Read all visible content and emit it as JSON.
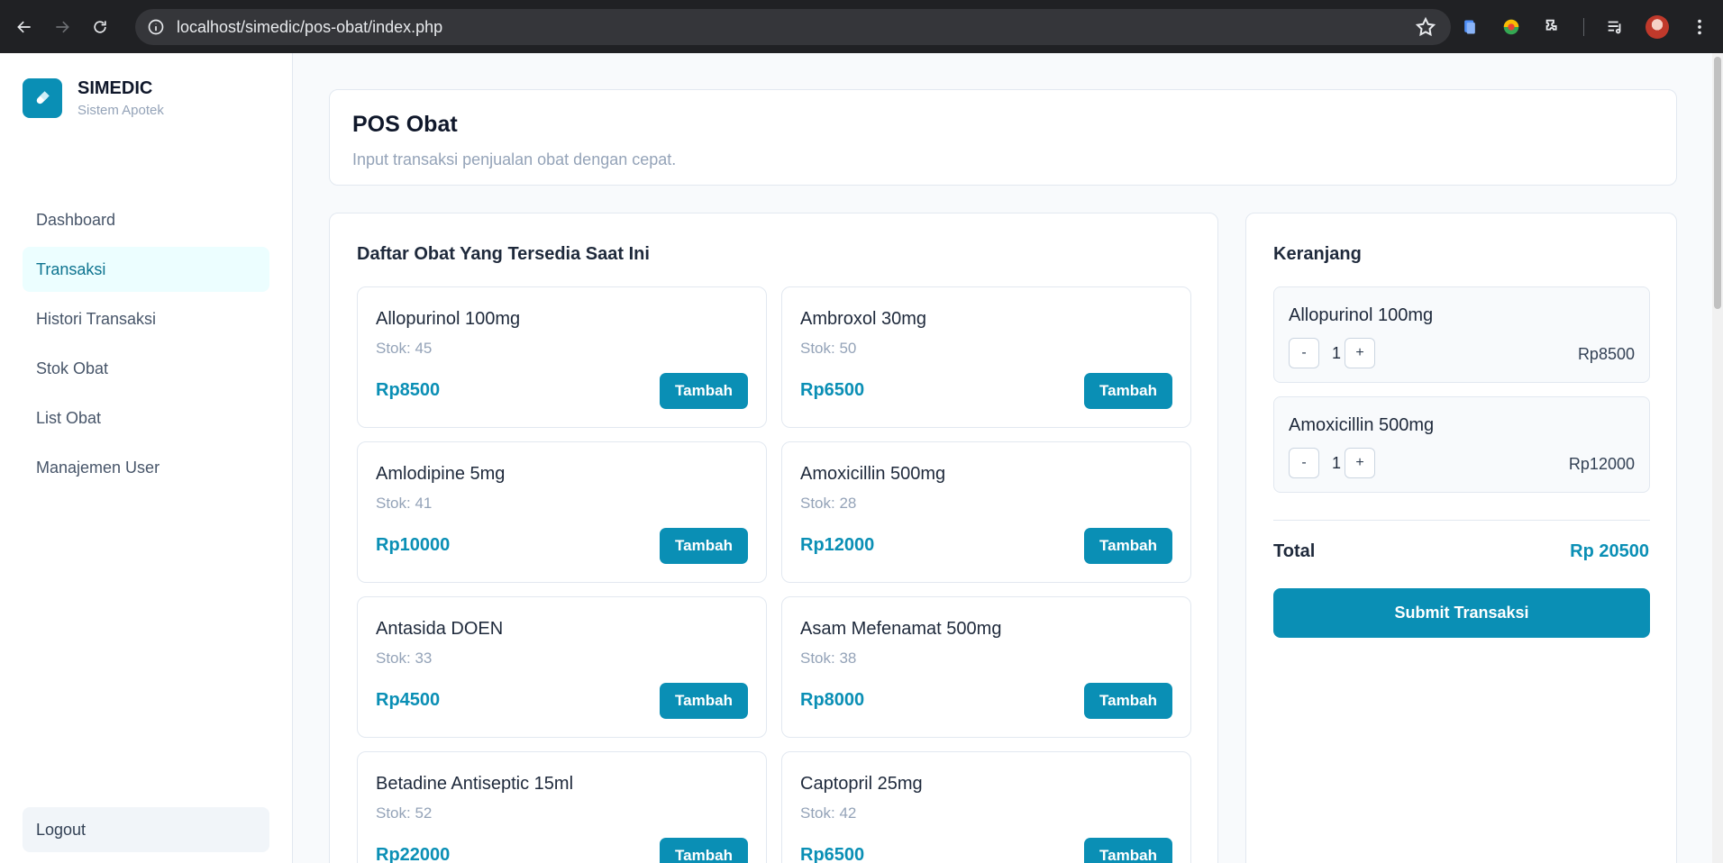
{
  "browser": {
    "url": "localhost/simedic/pos-obat/index.php",
    "icons": [
      "back-icon",
      "forward-icon",
      "reload-icon",
      "info-icon",
      "star-icon",
      "extension-icon",
      "menu-icon"
    ]
  },
  "brand": {
    "name": "SIMEDIC",
    "subtitle": "Sistem Apotek",
    "color": "#0a8fb5"
  },
  "sidebar": {
    "items": [
      {
        "label": "Dashboard"
      },
      {
        "label": "Transaksi",
        "active": true
      },
      {
        "label": "Histori Transaksi"
      },
      {
        "label": "Stok Obat"
      },
      {
        "label": "List Obat"
      },
      {
        "label": "Manajemen User"
      }
    ],
    "logout": "Logout"
  },
  "header": {
    "title": "POS Obat",
    "subtitle": "Input transaksi penjualan obat dengan cepat."
  },
  "products": {
    "title": "Daftar Obat Yang Tersedia Saat Ini",
    "button_label": "Tambah",
    "items": [
      {
        "name": "Allopurinol 100mg",
        "stock": "Stok: 45",
        "price": "Rp8500"
      },
      {
        "name": "Ambroxol 30mg",
        "stock": "Stok: 50",
        "price": "Rp6500"
      },
      {
        "name": "Amlodipine 5mg",
        "stock": "Stok: 41",
        "price": "Rp10000"
      },
      {
        "name": "Amoxicillin 500mg",
        "stock": "Stok: 28",
        "price": "Rp12000"
      },
      {
        "name": "Antasida DOEN",
        "stock": "Stok: 33",
        "price": "Rp4500"
      },
      {
        "name": "Asam Mefenamat 500mg",
        "stock": "Stok: 38",
        "price": "Rp8000"
      },
      {
        "name": "Betadine Antiseptic 15ml",
        "stock": "Stok: 52",
        "price": "Rp22000"
      },
      {
        "name": "Captopril 25mg",
        "stock": "Stok: 42",
        "price": "Rp6500"
      }
    ]
  },
  "cart": {
    "title": "Keranjang",
    "minus": "-",
    "plus": "+",
    "items": [
      {
        "name": "Allopurinol 100mg",
        "qty": "1",
        "price": "Rp8500"
      },
      {
        "name": "Amoxicillin 500mg",
        "qty": "1",
        "price": "Rp12000"
      }
    ],
    "total_label": "Total",
    "total_value": "Rp 20500",
    "submit_label": "Submit Transaksi"
  }
}
